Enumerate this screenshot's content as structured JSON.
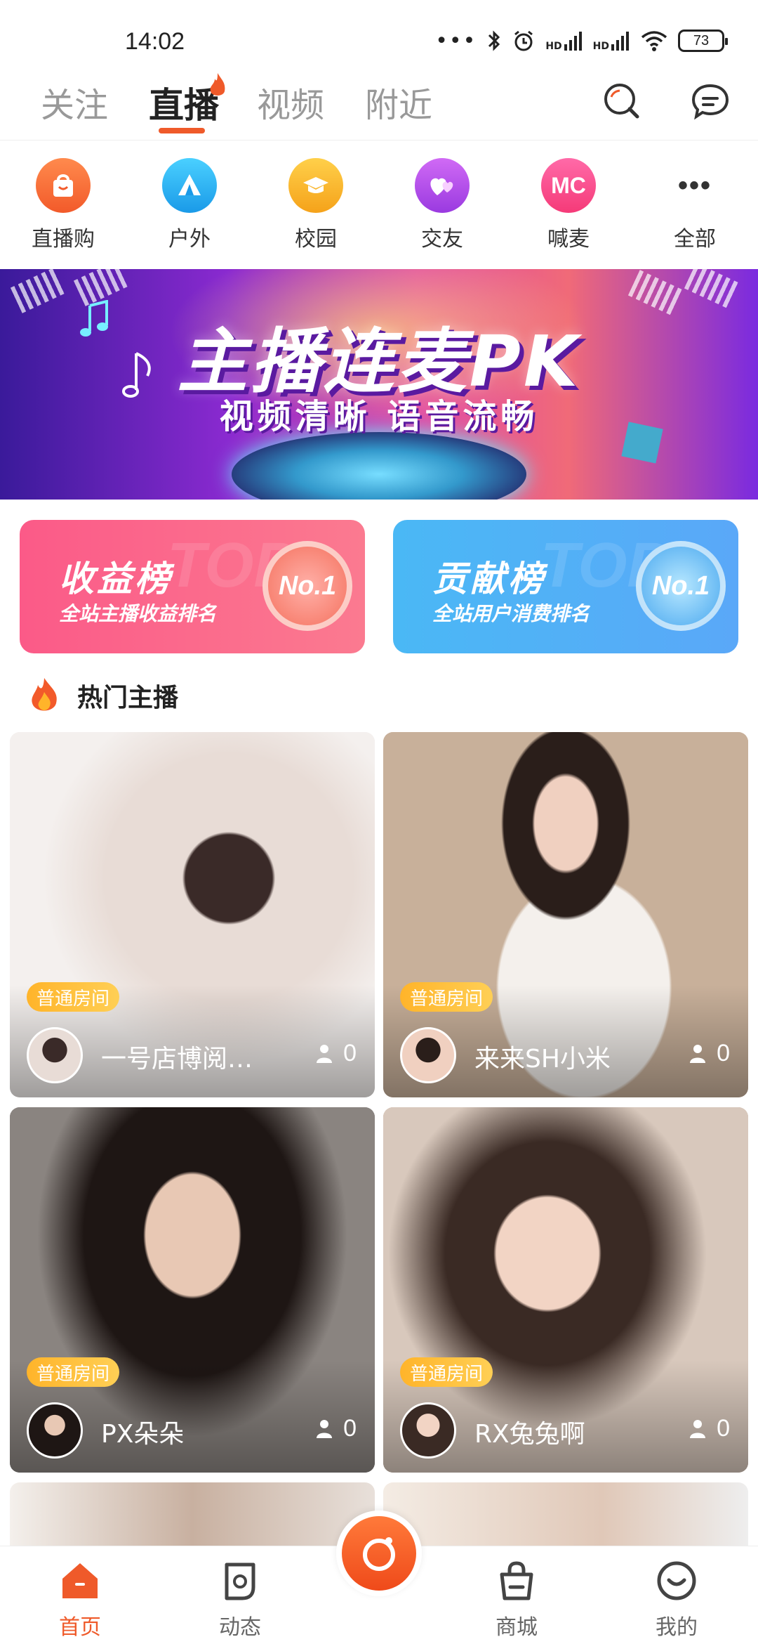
{
  "status_bar": {
    "time": "14:02",
    "dots": "•••",
    "hd1": "HD",
    "hd2": "HD",
    "battery": "73"
  },
  "top_tabs": [
    {
      "label": "关注",
      "active": false
    },
    {
      "label": "直播",
      "active": true
    },
    {
      "label": "视频",
      "active": false
    },
    {
      "label": "附近",
      "active": false
    }
  ],
  "categories": [
    {
      "label": "直播购",
      "icon": "shopping-bag-icon",
      "color": "#ff6a3d"
    },
    {
      "label": "户外",
      "icon": "tent-icon",
      "color": "#2ab4f0"
    },
    {
      "label": "校园",
      "icon": "graduation-cap-icon",
      "color": "#f7b52a"
    },
    {
      "label": "交友",
      "icon": "hearts-icon",
      "color": "#b04ae8"
    },
    {
      "label": "喊麦",
      "icon": "mc-icon",
      "icon_text": "MC",
      "color": "#ff4a8a"
    },
    {
      "label": "全部",
      "icon": "more-dots-icon",
      "icon_text": "•••",
      "color": "#333333"
    }
  ],
  "banner": {
    "title": "主播连麦PK",
    "subtitle": "视频清晰  语音流畅"
  },
  "rank_cards": [
    {
      "title": "收益榜",
      "subtitle": "全站主播收益排名",
      "badge": "No.1",
      "watermark": "TOP"
    },
    {
      "title": "贡献榜",
      "subtitle": "全站用户消费排名",
      "badge": "No.1",
      "watermark": "TOP"
    }
  ],
  "section": {
    "title": "热门主播"
  },
  "streams": [
    {
      "tag": "普通房间",
      "name": "一号店博阅…",
      "viewers": "0",
      "photo_color": "#d8d2ce"
    },
    {
      "tag": "普通房间",
      "name": "来来SH小米",
      "viewers": "0",
      "photo_color": "#c9b8a8"
    },
    {
      "tag": "普通房间",
      "name": "PX朵朵",
      "viewers": "0",
      "photo_color": "#a9a39e"
    },
    {
      "tag": "普通房间",
      "name": "RX兔兔啊",
      "viewers": "0",
      "photo_color": "#c8a898"
    }
  ],
  "bottom_nav": [
    {
      "label": "首页",
      "icon": "home-icon",
      "active": true
    },
    {
      "label": "动态",
      "icon": "moments-icon",
      "active": false
    },
    {
      "label": "商城",
      "icon": "shop-bag-icon",
      "active": false
    },
    {
      "label": "我的",
      "icon": "profile-icon",
      "active": false
    }
  ],
  "colors": {
    "accent": "#ef5a2a",
    "tag_yellow": "#ffb42a"
  }
}
